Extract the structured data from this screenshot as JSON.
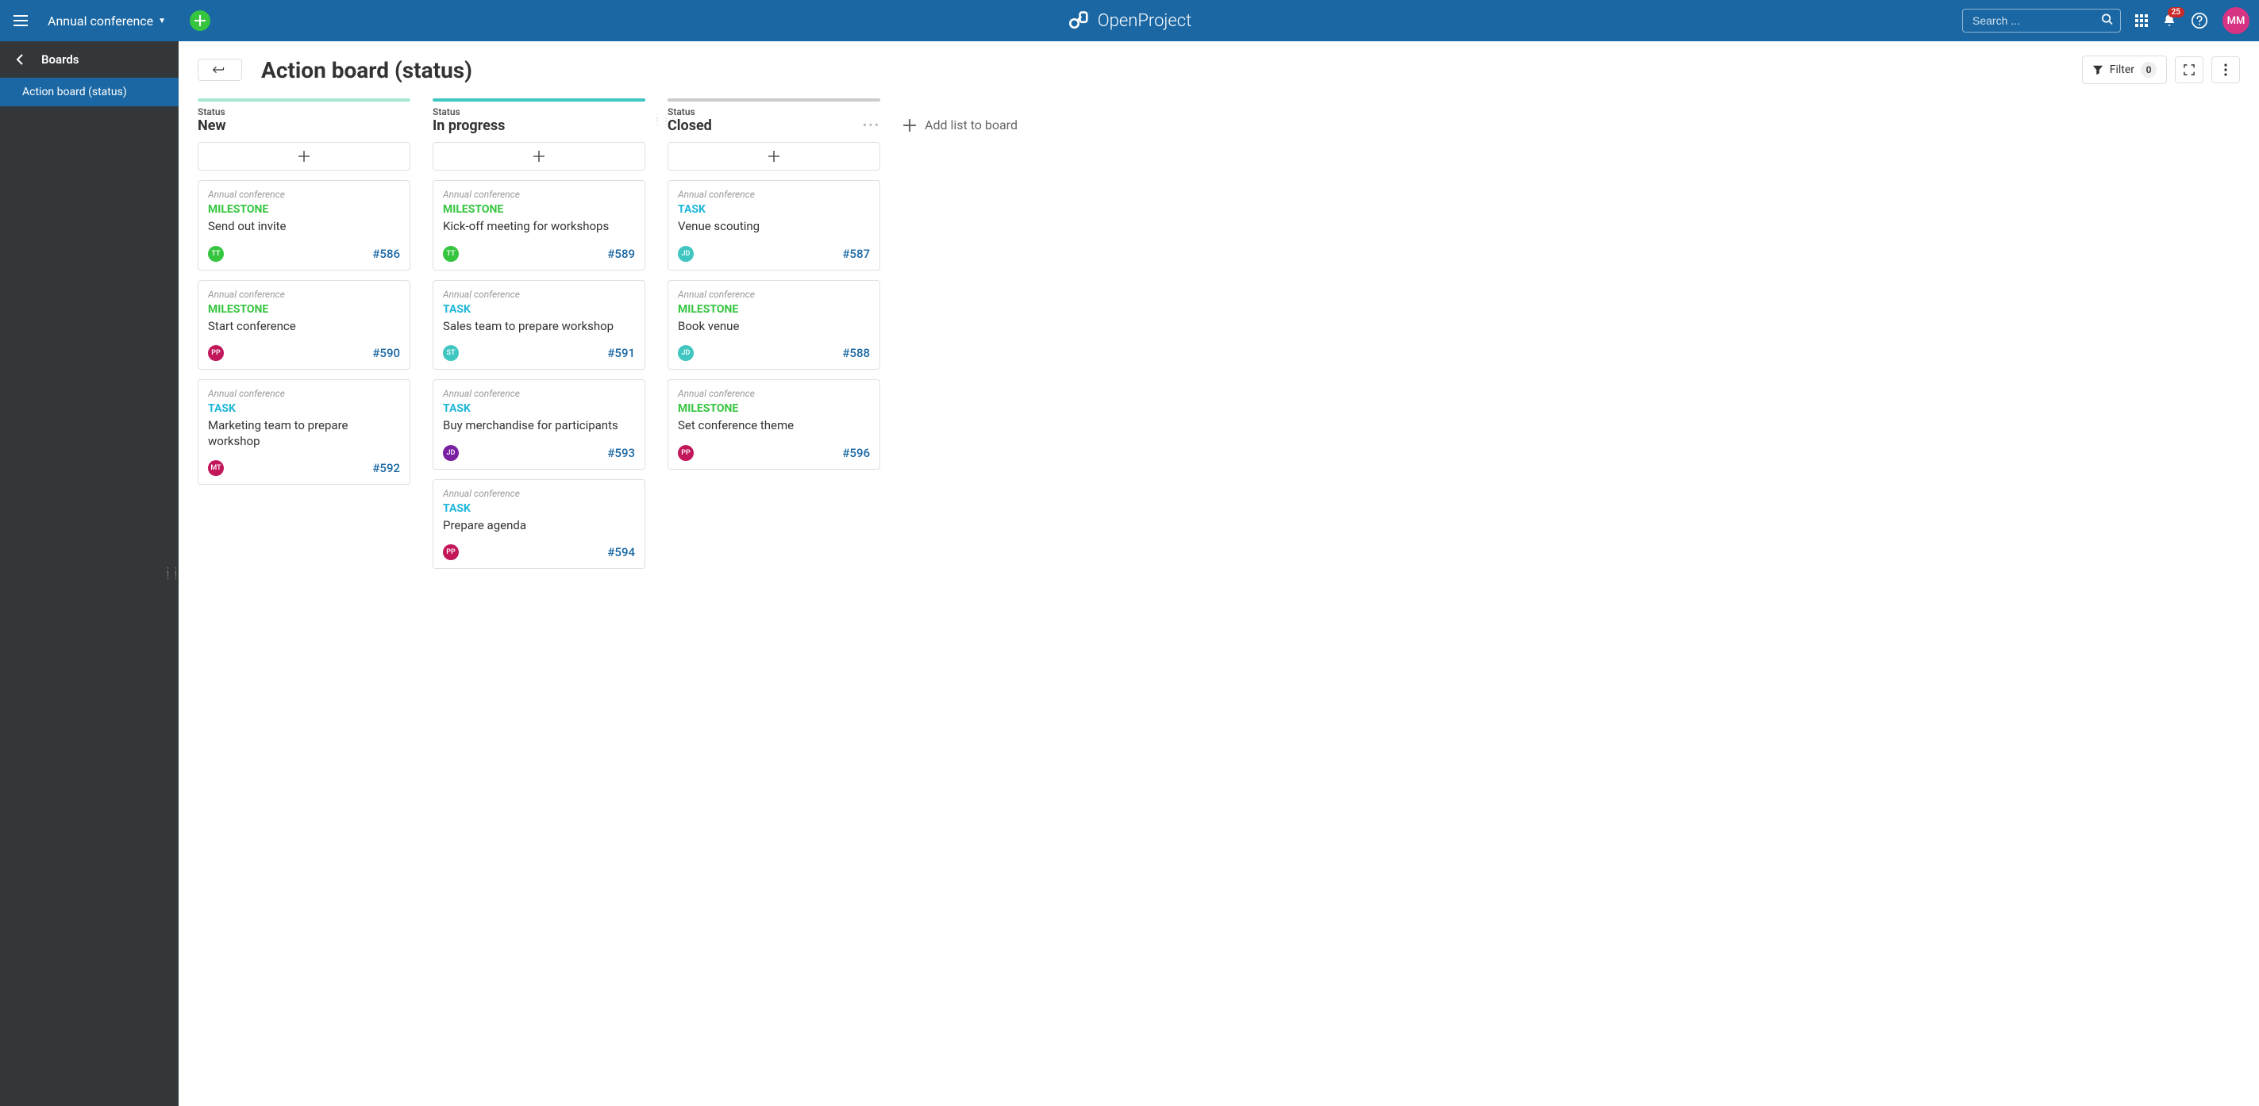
{
  "header": {
    "project": "Annual conference",
    "brand": "OpenProject",
    "search_placeholder": "Search ...",
    "notification_count": "25",
    "user_initials": "MM"
  },
  "sidebar": {
    "back_label": "Boards",
    "active_item": "Action board (status)"
  },
  "page": {
    "title": "Action board (status)",
    "filter_label": "Filter",
    "filter_count": "0",
    "add_list_label": "Add list to board"
  },
  "columns": [
    {
      "label": "Status",
      "title": "New",
      "bar_color": "#a8e6d4",
      "show_more": false,
      "show_drag": false,
      "cards": [
        {
          "project": "Annual conference",
          "type": "MILESTONE",
          "type_class": "milestone",
          "title": "Send out invite",
          "avatar": "TT",
          "avatar_color": "#35c53f",
          "id": "#586"
        },
        {
          "project": "Annual conference",
          "type": "MILESTONE",
          "type_class": "milestone",
          "title": "Start conference",
          "avatar": "PP",
          "avatar_color": "#c2185b",
          "id": "#590"
        },
        {
          "project": "Annual conference",
          "type": "TASK",
          "type_class": "task",
          "title": "Marketing team to prepare workshop",
          "avatar": "MT",
          "avatar_color": "#c2185b",
          "id": "#592"
        }
      ]
    },
    {
      "label": "Status",
      "title": "In progress",
      "bar_color": "#3fc6c0",
      "show_more": false,
      "show_drag": false,
      "cards": [
        {
          "project": "Annual conference",
          "type": "MILESTONE",
          "type_class": "milestone",
          "title": "Kick-off meeting for workshops",
          "avatar": "TT",
          "avatar_color": "#35c53f",
          "id": "#589"
        },
        {
          "project": "Annual conference",
          "type": "TASK",
          "type_class": "task",
          "title": "Sales team to prepare workshop",
          "avatar": "ST",
          "avatar_color": "#3fc6c0",
          "id": "#591"
        },
        {
          "project": "Annual conference",
          "type": "TASK",
          "type_class": "task",
          "title": "Buy merchandise for participants",
          "avatar": "JD",
          "avatar_color": "#7b1fa2",
          "id": "#593"
        },
        {
          "project": "Annual conference",
          "type": "TASK",
          "type_class": "task",
          "title": "Prepare agenda",
          "avatar": "PP",
          "avatar_color": "#c2185b",
          "id": "#594"
        }
      ]
    },
    {
      "label": "Status",
      "title": "Closed",
      "bar_color": "#cccccc",
      "show_more": true,
      "show_drag": true,
      "cards": [
        {
          "project": "Annual conference",
          "type": "TASK",
          "type_class": "task",
          "title": "Venue scouting",
          "avatar": "JD",
          "avatar_color": "#3fc6c0",
          "id": "#587"
        },
        {
          "project": "Annual conference",
          "type": "MILESTONE",
          "type_class": "milestone",
          "title": "Book venue",
          "avatar": "JD",
          "avatar_color": "#3fc6c0",
          "id": "#588"
        },
        {
          "project": "Annual conference",
          "type": "MILESTONE",
          "type_class": "milestone",
          "title": "Set conference theme",
          "avatar": "PP",
          "avatar_color": "#c2185b",
          "id": "#596"
        }
      ]
    }
  ]
}
